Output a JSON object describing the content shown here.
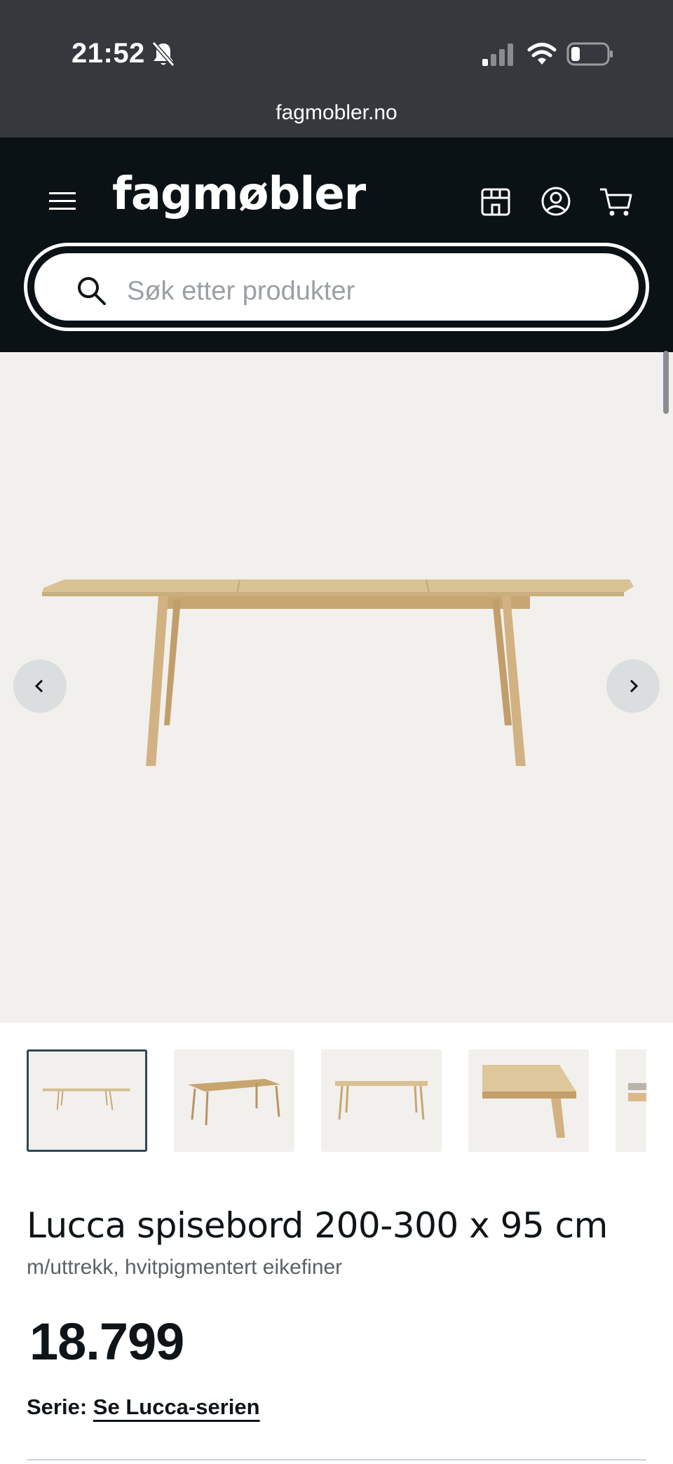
{
  "status_bar": {
    "time": "21:52",
    "url": "fagmobler.no"
  },
  "header": {
    "logo": "fagmøbler",
    "icons": [
      "menu-icon",
      "store-icon",
      "account-icon",
      "cart-icon"
    ],
    "background": "#0b1215"
  },
  "search": {
    "placeholder": "Søk etter produkter",
    "value": ""
  },
  "gallery": {
    "prev_icon": "chevron-left-icon",
    "next_icon": "chevron-right-icon",
    "background": "#f2f0ed",
    "thumbnail_count": 5,
    "active_thumbnail": 1
  },
  "product": {
    "title": "Lucca spisebord 200-300 x 95 cm",
    "subtitle": "m/uttrekk, hvitpigmentert eikefiner",
    "price": "18.799",
    "series_label": "Serie:",
    "series_link": "Se Lucca-serien"
  },
  "colors": {
    "accent": "#2d4854",
    "wood": "#d9bf8f"
  }
}
